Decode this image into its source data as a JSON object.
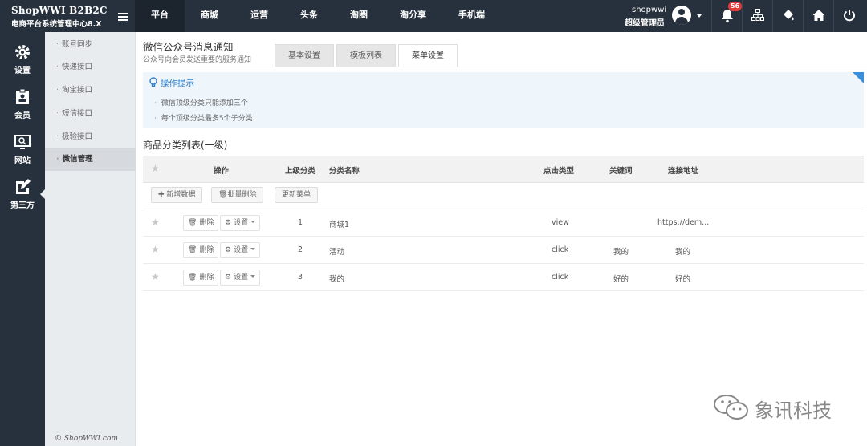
{
  "brand": {
    "title": "ShopWWI B2B2C",
    "subtitle": "电商平台系统管理中心8.X"
  },
  "topnav": [
    "平台",
    "商城",
    "运营",
    "头条",
    "淘圈",
    "淘分享",
    "手机端"
  ],
  "user": {
    "name": "shopwwi",
    "role": "超级管理员"
  },
  "notifications": {
    "count": "56"
  },
  "icons": {
    "tools": [
      "bell-icon",
      "sitemap-icon",
      "paint-bucket-icon",
      "home-icon",
      "power-icon"
    ]
  },
  "iconbar": [
    {
      "label": "设置",
      "icon": "gear-icon"
    },
    {
      "label": "会员",
      "icon": "member-card-icon"
    },
    {
      "label": "网站",
      "icon": "monitor-icon"
    },
    {
      "label": "第三方",
      "icon": "edit-icon"
    }
  ],
  "submenu": [
    "账号同步",
    "快递接口",
    "淘宝接口",
    "短信接口",
    "极验接口",
    "微信管理"
  ],
  "copyright": "© ShopWWI.com",
  "page": {
    "title": "微信公众号消息通知",
    "subtitle": "公众号向会员发送重要的服务通知"
  },
  "tabs": [
    "基本设置",
    "模板列表",
    "菜单设置"
  ],
  "tips": {
    "heading": "操作提示",
    "lines": [
      "微信顶级分类只能添加三个",
      "每个顶级分类最多5个子分类"
    ]
  },
  "section_title": "商品分类列表(一级)",
  "table": {
    "headers": [
      "操作",
      "上级分类",
      "分类名称",
      "点击类型",
      "关键词",
      "连接地址"
    ],
    "actions": [
      "新增数据",
      "批量删除",
      "更新菜单"
    ],
    "row_buttons": {
      "delete": "删除",
      "settings": "设置"
    },
    "rows": [
      {
        "parent": "1",
        "name": "商城1",
        "type": "view",
        "keyword": "",
        "url": "https://dem..."
      },
      {
        "parent": "2",
        "name": "活动",
        "type": "click",
        "keyword": "我的",
        "url": "我的"
      },
      {
        "parent": "3",
        "name": "我的",
        "type": "click",
        "keyword": "好的",
        "url": "好的"
      }
    ]
  },
  "watermark": "象讯科技",
  "colors": {
    "topbar": "#27313d",
    "accent": "#2f7fca",
    "badge": "#e23b3b"
  }
}
